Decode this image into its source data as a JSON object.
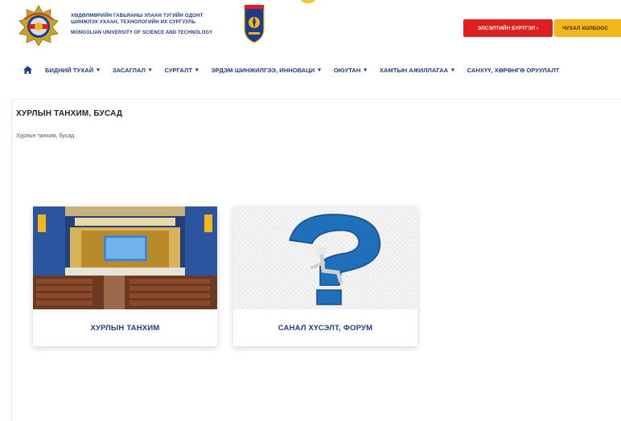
{
  "header": {
    "university_name_mn_line1": "ХӨДӨЛМӨРИЙН ГАВЬЯАНЫ УЛААН ТУГИЙН ОДОНТ",
    "university_name_mn_line2": "ШИНЖЛЭХ УХААН, ТЕХНОЛОГИЙН ИХ СУРГУУЛЬ",
    "university_name_en": "MONGOLIAN UNIVERSITY OF SCIENCE AND TECHNOLOGY",
    "apply_button": "ЭЛСЭЛТИЙН БҮРТГЭЛ ›",
    "links_button": "ЧУХАЛ ХОЛБООС",
    "colors": {
      "brand_blue": "#1f3c88",
      "apply_red": "#e02020",
      "links_yellow": "#f2b51c"
    }
  },
  "nav": {
    "items": [
      {
        "label": "БИДНИЙ ТУХАЙ",
        "caret": "▾"
      },
      {
        "label": "ЗАСАГЛАЛ",
        "caret": "▾"
      },
      {
        "label": "СУРГАЛТ",
        "caret": "▾"
      },
      {
        "label": "ЭРДЭМ ШИНЖИЛГЭЭ, ИННОВАЦИ",
        "caret": "▾"
      },
      {
        "label": "ОЮУТАН",
        "caret": "▾"
      },
      {
        "label": "ХАМТЫН АЖИЛЛАГАА",
        "caret": "▾"
      },
      {
        "label": "САНХҮҮ, ХӨРӨНГӨ ОРУУЛАЛТ",
        "caret": ""
      }
    ]
  },
  "page": {
    "title": "ХУРЛЫН ТАНХИМ, БУСАД",
    "breadcrumb": "Хурлын танхим, бусад"
  },
  "cards": [
    {
      "label": "ХУРЛЫН ТАНХИМ",
      "image": "conference-hall-photo"
    },
    {
      "label": "САНАЛ ХҮСЭЛТ, ФОРУМ",
      "image": "question-mark-figure"
    }
  ]
}
